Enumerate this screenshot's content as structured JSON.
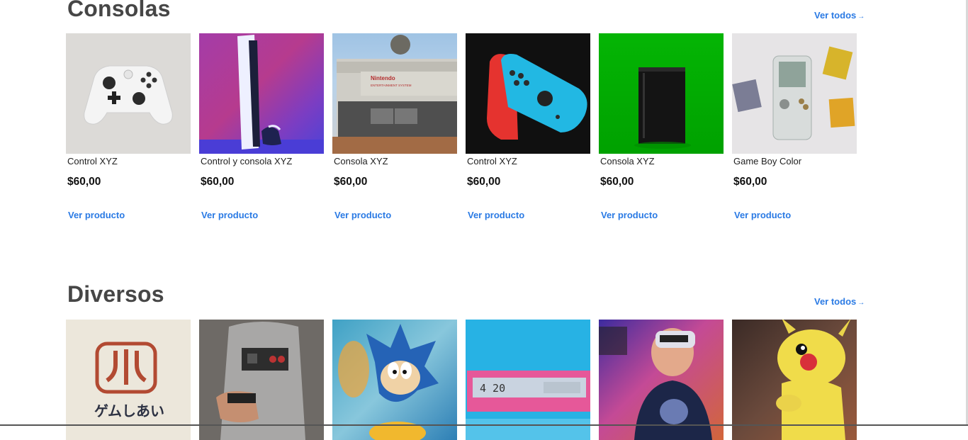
{
  "sections": [
    {
      "title": "Consolas",
      "view_all": "Ver todos",
      "products": [
        {
          "name": "Control XYZ",
          "price": "$60,00",
          "link": "Ver producto"
        },
        {
          "name": "Control y consola XYZ",
          "price": "$60,00",
          "link": "Ver producto"
        },
        {
          "name": "Consola XYZ",
          "price": "$60,00",
          "link": "Ver producto",
          "label1": "Nintendo",
          "label2": "ENTERTAINMENT SYSTEM"
        },
        {
          "name": "Control XYZ",
          "price": "$60,00",
          "link": "Ver producto"
        },
        {
          "name": "Consola XYZ",
          "price": "$60,00",
          "link": "Ver producto"
        },
        {
          "name": "Game Boy Color",
          "price": "$60,00",
          "link": "Ver producto"
        }
      ]
    },
    {
      "title": "Diversos",
      "view_all": "Ver todos",
      "shirt_text": "ゲムしあい",
      "clock_text": "4 20"
    }
  ],
  "colors": {
    "accent": "#2a7ae4",
    "title": "#464646"
  }
}
